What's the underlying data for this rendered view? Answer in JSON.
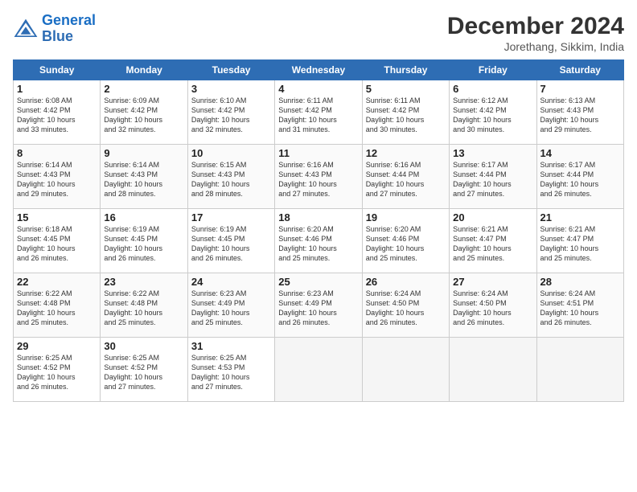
{
  "header": {
    "logo_line1": "General",
    "logo_line2": "Blue",
    "title": "December 2024",
    "subtitle": "Jorethang, Sikkim, India"
  },
  "days_of_week": [
    "Sunday",
    "Monday",
    "Tuesday",
    "Wednesday",
    "Thursday",
    "Friday",
    "Saturday"
  ],
  "weeks": [
    [
      {
        "num": "1",
        "info": "Sunrise: 6:08 AM\nSunset: 4:42 PM\nDaylight: 10 hours\nand 33 minutes."
      },
      {
        "num": "2",
        "info": "Sunrise: 6:09 AM\nSunset: 4:42 PM\nDaylight: 10 hours\nand 32 minutes."
      },
      {
        "num": "3",
        "info": "Sunrise: 6:10 AM\nSunset: 4:42 PM\nDaylight: 10 hours\nand 32 minutes."
      },
      {
        "num": "4",
        "info": "Sunrise: 6:11 AM\nSunset: 4:42 PM\nDaylight: 10 hours\nand 31 minutes."
      },
      {
        "num": "5",
        "info": "Sunrise: 6:11 AM\nSunset: 4:42 PM\nDaylight: 10 hours\nand 30 minutes."
      },
      {
        "num": "6",
        "info": "Sunrise: 6:12 AM\nSunset: 4:42 PM\nDaylight: 10 hours\nand 30 minutes."
      },
      {
        "num": "7",
        "info": "Sunrise: 6:13 AM\nSunset: 4:43 PM\nDaylight: 10 hours\nand 29 minutes."
      }
    ],
    [
      {
        "num": "8",
        "info": "Sunrise: 6:14 AM\nSunset: 4:43 PM\nDaylight: 10 hours\nand 29 minutes."
      },
      {
        "num": "9",
        "info": "Sunrise: 6:14 AM\nSunset: 4:43 PM\nDaylight: 10 hours\nand 28 minutes."
      },
      {
        "num": "10",
        "info": "Sunrise: 6:15 AM\nSunset: 4:43 PM\nDaylight: 10 hours\nand 28 minutes."
      },
      {
        "num": "11",
        "info": "Sunrise: 6:16 AM\nSunset: 4:43 PM\nDaylight: 10 hours\nand 27 minutes."
      },
      {
        "num": "12",
        "info": "Sunrise: 6:16 AM\nSunset: 4:44 PM\nDaylight: 10 hours\nand 27 minutes."
      },
      {
        "num": "13",
        "info": "Sunrise: 6:17 AM\nSunset: 4:44 PM\nDaylight: 10 hours\nand 27 minutes."
      },
      {
        "num": "14",
        "info": "Sunrise: 6:17 AM\nSunset: 4:44 PM\nDaylight: 10 hours\nand 26 minutes."
      }
    ],
    [
      {
        "num": "15",
        "info": "Sunrise: 6:18 AM\nSunset: 4:45 PM\nDaylight: 10 hours\nand 26 minutes."
      },
      {
        "num": "16",
        "info": "Sunrise: 6:19 AM\nSunset: 4:45 PM\nDaylight: 10 hours\nand 26 minutes."
      },
      {
        "num": "17",
        "info": "Sunrise: 6:19 AM\nSunset: 4:45 PM\nDaylight: 10 hours\nand 26 minutes."
      },
      {
        "num": "18",
        "info": "Sunrise: 6:20 AM\nSunset: 4:46 PM\nDaylight: 10 hours\nand 25 minutes."
      },
      {
        "num": "19",
        "info": "Sunrise: 6:20 AM\nSunset: 4:46 PM\nDaylight: 10 hours\nand 25 minutes."
      },
      {
        "num": "20",
        "info": "Sunrise: 6:21 AM\nSunset: 4:47 PM\nDaylight: 10 hours\nand 25 minutes."
      },
      {
        "num": "21",
        "info": "Sunrise: 6:21 AM\nSunset: 4:47 PM\nDaylight: 10 hours\nand 25 minutes."
      }
    ],
    [
      {
        "num": "22",
        "info": "Sunrise: 6:22 AM\nSunset: 4:48 PM\nDaylight: 10 hours\nand 25 minutes."
      },
      {
        "num": "23",
        "info": "Sunrise: 6:22 AM\nSunset: 4:48 PM\nDaylight: 10 hours\nand 25 minutes."
      },
      {
        "num": "24",
        "info": "Sunrise: 6:23 AM\nSunset: 4:49 PM\nDaylight: 10 hours\nand 25 minutes."
      },
      {
        "num": "25",
        "info": "Sunrise: 6:23 AM\nSunset: 4:49 PM\nDaylight: 10 hours\nand 26 minutes."
      },
      {
        "num": "26",
        "info": "Sunrise: 6:24 AM\nSunset: 4:50 PM\nDaylight: 10 hours\nand 26 minutes."
      },
      {
        "num": "27",
        "info": "Sunrise: 6:24 AM\nSunset: 4:50 PM\nDaylight: 10 hours\nand 26 minutes."
      },
      {
        "num": "28",
        "info": "Sunrise: 6:24 AM\nSunset: 4:51 PM\nDaylight: 10 hours\nand 26 minutes."
      }
    ],
    [
      {
        "num": "29",
        "info": "Sunrise: 6:25 AM\nSunset: 4:52 PM\nDaylight: 10 hours\nand 26 minutes."
      },
      {
        "num": "30",
        "info": "Sunrise: 6:25 AM\nSunset: 4:52 PM\nDaylight: 10 hours\nand 27 minutes."
      },
      {
        "num": "31",
        "info": "Sunrise: 6:25 AM\nSunset: 4:53 PM\nDaylight: 10 hours\nand 27 minutes."
      },
      {
        "num": "",
        "info": ""
      },
      {
        "num": "",
        "info": ""
      },
      {
        "num": "",
        "info": ""
      },
      {
        "num": "",
        "info": ""
      }
    ]
  ]
}
